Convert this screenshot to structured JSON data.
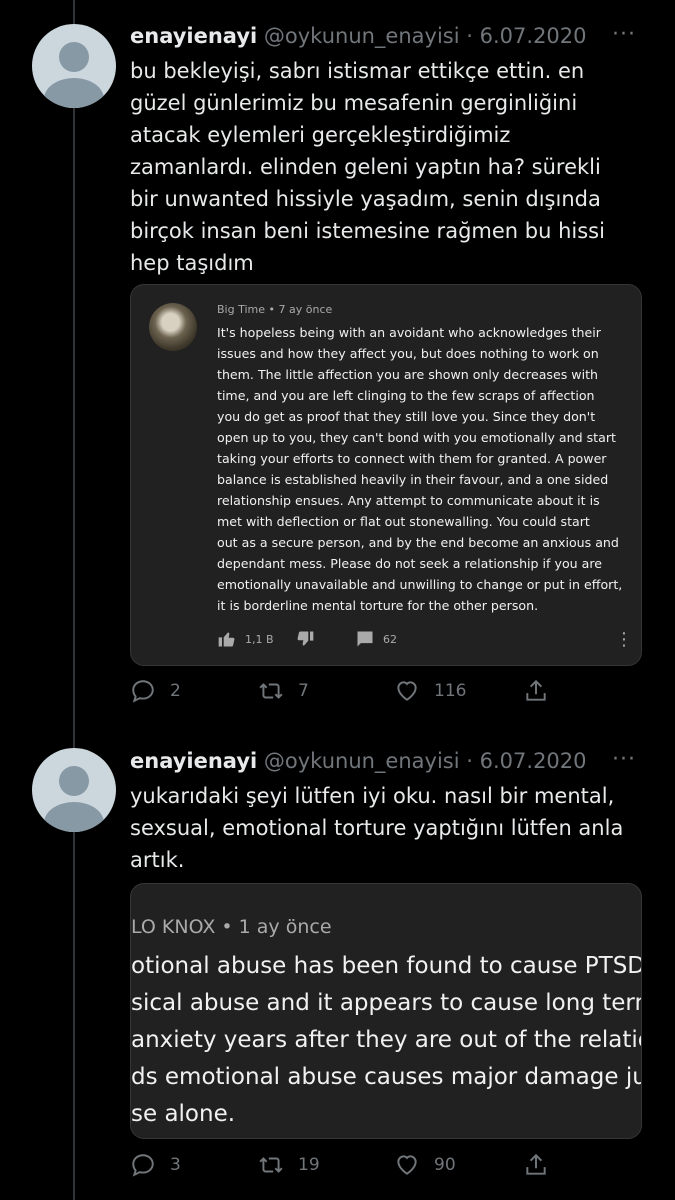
{
  "tweets": [
    {
      "name": "enayienayi",
      "handle": "@oykunun_enayisi",
      "separator": "·",
      "date": "6.07.2020",
      "more": "···",
      "lines": [
        "bu bekleyişi, sabrı istismar ettikçe ettin. en",
        "güzel günlerimiz bu mesafenin gerginliğini",
        "atacak eylemleri gerçekleştirdiğimiz",
        "zamanlardı. elinden geleni yaptın ha? sürekli",
        "bir unwanted hissiyle yaşadım, senin dışında",
        "birçok insan beni istemesine rağmen bu hissi",
        "hep taşıdım"
      ],
      "media": {
        "author": "Big Time",
        "time": "7 ay önce",
        "separator": "•",
        "lines": [
          "It's hopeless being with an avoidant who acknowledges their",
          "issues and how they affect you, but does nothing to work on",
          "them. The little affection you are shown only decreases with",
          "time, and you are left clinging to the few scraps of affection",
          "you do get as proof that they still love you. Since they don't",
          "open up to you, they can't bond with you emotionally and start",
          "taking your efforts to connect with them for granted. A power",
          "balance is established heavily in their favour, and a one sided",
          "relationship ensues. Any attempt to communicate about it is",
          "met with deflection or flat out stonewalling. You could start",
          "out as a secure person, and by the end become an anxious and",
          "dependant mess. Please do not seek a relationship if you are",
          "emotionally unavailable and unwilling to change or put in effort,",
          "it is borderline mental torture for the other person."
        ],
        "likes": "1,1 B",
        "replies": "62",
        "menu": "⋮"
      },
      "stats": {
        "replies": "2",
        "retweets": "7",
        "likes": "116"
      }
    },
    {
      "name": "enayienayi",
      "handle": "@oykunun_enayisi",
      "separator": "·",
      "date": "6.07.2020",
      "more": "···",
      "lines": [
        "yukarıdaki şeyi lütfen iyi oku. nasıl bir mental,",
        "sexsual, emotional torture yaptığını lütfen anla",
        "artık."
      ],
      "media": {
        "author": "LO KNOX",
        "time": "1 ay önce",
        "separator": "•",
        "lines": [
          "otional abuse has been found to cause PTSD s",
          "sical abuse and it appears to cause long term",
          "anxiety years after they are out of the relation",
          "ds emotional abuse causes major damage jus",
          "se alone."
        ]
      },
      "stats": {
        "replies": "3",
        "retweets": "19",
        "likes": "90"
      }
    }
  ],
  "colors": {
    "background": "#000000",
    "text": "#e7e9ea",
    "muted": "#71767b",
    "card": "#212121",
    "thread": "#2f3336"
  }
}
